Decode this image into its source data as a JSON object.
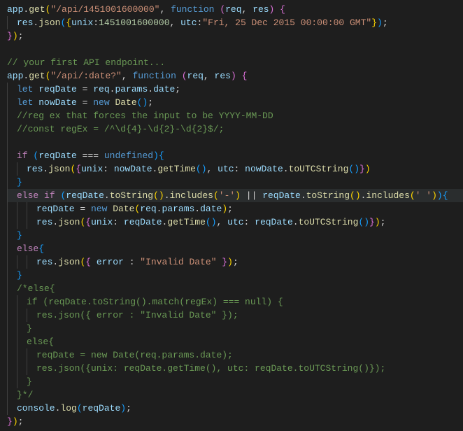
{
  "lines": [
    {
      "indent": 0,
      "tokens": [
        {
          "c": "t-obj",
          "t": "app"
        },
        {
          "c": "t-pun",
          "t": "."
        },
        {
          "c": "t-fn",
          "t": "get"
        },
        {
          "c": "t-brc",
          "t": "("
        },
        {
          "c": "t-str",
          "t": "\"/api/1451001600000\""
        },
        {
          "c": "t-pun",
          "t": ", "
        },
        {
          "c": "t-kw",
          "t": "function"
        },
        {
          "c": "t-pun",
          "t": " "
        },
        {
          "c": "t-brc2",
          "t": "("
        },
        {
          "c": "t-obj",
          "t": "req"
        },
        {
          "c": "t-pun",
          "t": ", "
        },
        {
          "c": "t-obj",
          "t": "res"
        },
        {
          "c": "t-brc2",
          "t": ")"
        },
        {
          "c": "t-pun",
          "t": " "
        },
        {
          "c": "t-brc2",
          "t": "{"
        }
      ]
    },
    {
      "indent": 1,
      "tokens": [
        {
          "c": "t-obj",
          "t": "res"
        },
        {
          "c": "t-pun",
          "t": "."
        },
        {
          "c": "t-fn",
          "t": "json"
        },
        {
          "c": "t-brc3",
          "t": "("
        },
        {
          "c": "t-brc",
          "t": "{"
        },
        {
          "c": "t-obj",
          "t": "unix"
        },
        {
          "c": "t-pun",
          "t": ":"
        },
        {
          "c": "t-num",
          "t": "1451001600000"
        },
        {
          "c": "t-pun",
          "t": ", "
        },
        {
          "c": "t-obj",
          "t": "utc"
        },
        {
          "c": "t-pun",
          "t": ":"
        },
        {
          "c": "t-str",
          "t": "\"Fri, 25 Dec 2015 00:00:00 GMT\""
        },
        {
          "c": "t-brc",
          "t": "}"
        },
        {
          "c": "t-brc3",
          "t": ")"
        },
        {
          "c": "t-pun",
          "t": ";"
        }
      ]
    },
    {
      "indent": 0,
      "tokens": [
        {
          "c": "t-brc2",
          "t": "}"
        },
        {
          "c": "t-brc",
          "t": ")"
        },
        {
          "c": "t-pun",
          "t": ";"
        }
      ]
    },
    {
      "indent": 0,
      "tokens": []
    },
    {
      "indent": 0,
      "tokens": [
        {
          "c": "t-com",
          "t": "// your first API endpoint... "
        }
      ]
    },
    {
      "indent": 0,
      "tokens": [
        {
          "c": "t-obj",
          "t": "app"
        },
        {
          "c": "t-pun",
          "t": "."
        },
        {
          "c": "t-fn",
          "t": "get"
        },
        {
          "c": "t-brc",
          "t": "("
        },
        {
          "c": "t-str",
          "t": "\"/api/:date?\""
        },
        {
          "c": "t-pun",
          "t": ", "
        },
        {
          "c": "t-kw",
          "t": "function"
        },
        {
          "c": "t-pun",
          "t": " "
        },
        {
          "c": "t-brc2",
          "t": "("
        },
        {
          "c": "t-obj",
          "t": "req"
        },
        {
          "c": "t-pun",
          "t": ", "
        },
        {
          "c": "t-obj",
          "t": "res"
        },
        {
          "c": "t-brc2",
          "t": ")"
        },
        {
          "c": "t-pun",
          "t": " "
        },
        {
          "c": "t-brc2",
          "t": "{"
        }
      ]
    },
    {
      "indent": 1,
      "tokens": [
        {
          "c": "t-kw",
          "t": "let"
        },
        {
          "c": "t-pun",
          "t": " "
        },
        {
          "c": "t-obj",
          "t": "reqDate"
        },
        {
          "c": "t-pun",
          "t": " = "
        },
        {
          "c": "t-obj",
          "t": "req"
        },
        {
          "c": "t-pun",
          "t": "."
        },
        {
          "c": "t-obj",
          "t": "params"
        },
        {
          "c": "t-pun",
          "t": "."
        },
        {
          "c": "t-obj",
          "t": "date"
        },
        {
          "c": "t-pun",
          "t": ";"
        }
      ]
    },
    {
      "indent": 1,
      "tokens": [
        {
          "c": "t-kw",
          "t": "let"
        },
        {
          "c": "t-pun",
          "t": " "
        },
        {
          "c": "t-obj",
          "t": "nowDate"
        },
        {
          "c": "t-pun",
          "t": " = "
        },
        {
          "c": "t-kw",
          "t": "new"
        },
        {
          "c": "t-pun",
          "t": " "
        },
        {
          "c": "t-fn",
          "t": "Date"
        },
        {
          "c": "t-brc3",
          "t": "()"
        },
        {
          "c": "t-pun",
          "t": ";"
        }
      ]
    },
    {
      "indent": 1,
      "tokens": [
        {
          "c": "t-com",
          "t": "//reg ex that forces the input to be YYYY-MM-DD"
        }
      ]
    },
    {
      "indent": 1,
      "tokens": [
        {
          "c": "t-com",
          "t": "//const regEx = /^\\d{4}-\\d{2}-\\d{2}$/;"
        }
      ]
    },
    {
      "indent": 1,
      "tokens": []
    },
    {
      "indent": 1,
      "tokens": [
        {
          "c": "t-ctl",
          "t": "if"
        },
        {
          "c": "t-pun",
          "t": " "
        },
        {
          "c": "t-brc3",
          "t": "("
        },
        {
          "c": "t-obj",
          "t": "reqDate"
        },
        {
          "c": "t-pun",
          "t": " === "
        },
        {
          "c": "t-const",
          "t": "undefined"
        },
        {
          "c": "t-brc3",
          "t": ")"
        },
        {
          "c": "t-brc3",
          "t": "{"
        }
      ]
    },
    {
      "indent": 2,
      "tokens": [
        {
          "c": "t-obj",
          "t": "res"
        },
        {
          "c": "t-pun",
          "t": "."
        },
        {
          "c": "t-fn",
          "t": "json"
        },
        {
          "c": "t-brc",
          "t": "("
        },
        {
          "c": "t-brc2",
          "t": "{"
        },
        {
          "c": "t-obj",
          "t": "unix"
        },
        {
          "c": "t-pun",
          "t": ": "
        },
        {
          "c": "t-obj",
          "t": "nowDate"
        },
        {
          "c": "t-pun",
          "t": "."
        },
        {
          "c": "t-fn",
          "t": "getTime"
        },
        {
          "c": "t-brc3",
          "t": "()"
        },
        {
          "c": "t-pun",
          "t": ", "
        },
        {
          "c": "t-obj",
          "t": "utc"
        },
        {
          "c": "t-pun",
          "t": ": "
        },
        {
          "c": "t-obj",
          "t": "nowDate"
        },
        {
          "c": "t-pun",
          "t": "."
        },
        {
          "c": "t-fn",
          "t": "toUTCString"
        },
        {
          "c": "t-brc3",
          "t": "()"
        },
        {
          "c": "t-brc2",
          "t": "}"
        },
        {
          "c": "t-brc",
          "t": ")"
        }
      ]
    },
    {
      "indent": 1,
      "tokens": [
        {
          "c": "t-brc3",
          "t": "}"
        }
      ]
    },
    {
      "indent": 1,
      "hl": true,
      "tokens": [
        {
          "c": "t-ctl",
          "t": "else"
        },
        {
          "c": "t-pun",
          "t": " "
        },
        {
          "c": "t-ctl",
          "t": "if"
        },
        {
          "c": "t-pun",
          "t": " "
        },
        {
          "c": "t-brc3",
          "t": "("
        },
        {
          "c": "t-obj",
          "t": "reqDate"
        },
        {
          "c": "t-pun",
          "t": "."
        },
        {
          "c": "t-fn",
          "t": "toString"
        },
        {
          "c": "t-brc",
          "t": "()"
        },
        {
          "c": "t-pun",
          "t": "."
        },
        {
          "c": "t-fn",
          "t": "includes"
        },
        {
          "c": "t-brc",
          "t": "("
        },
        {
          "c": "t-str",
          "t": "'-'"
        },
        {
          "c": "t-brc",
          "t": ")"
        },
        {
          "c": "t-pun",
          "t": " || "
        },
        {
          "c": "t-obj",
          "t": "reqDate"
        },
        {
          "c": "t-pun",
          "t": "."
        },
        {
          "c": "t-fn",
          "t": "toString"
        },
        {
          "c": "t-brc",
          "t": "()"
        },
        {
          "c": "t-pun",
          "t": "."
        },
        {
          "c": "t-fn",
          "t": "includes"
        },
        {
          "c": "t-brc",
          "t": "("
        },
        {
          "c": "t-str",
          "t": "' '"
        },
        {
          "c": "t-brc",
          "t": ")"
        },
        {
          "c": "t-brc3",
          "t": ")"
        },
        {
          "c": "t-brc3",
          "t": "{"
        }
      ]
    },
    {
      "indent": 3,
      "tokens": [
        {
          "c": "t-obj",
          "t": "reqDate"
        },
        {
          "c": "t-pun",
          "t": " = "
        },
        {
          "c": "t-kw",
          "t": "new"
        },
        {
          "c": "t-pun",
          "t": " "
        },
        {
          "c": "t-fn",
          "t": "Date"
        },
        {
          "c": "t-brc",
          "t": "("
        },
        {
          "c": "t-obj",
          "t": "req"
        },
        {
          "c": "t-pun",
          "t": "."
        },
        {
          "c": "t-obj",
          "t": "params"
        },
        {
          "c": "t-pun",
          "t": "."
        },
        {
          "c": "t-obj",
          "t": "date"
        },
        {
          "c": "t-brc",
          "t": ")"
        },
        {
          "c": "t-pun",
          "t": ";"
        }
      ]
    },
    {
      "indent": 3,
      "tokens": [
        {
          "c": "t-obj",
          "t": "res"
        },
        {
          "c": "t-pun",
          "t": "."
        },
        {
          "c": "t-fn",
          "t": "json"
        },
        {
          "c": "t-brc",
          "t": "("
        },
        {
          "c": "t-brc2",
          "t": "{"
        },
        {
          "c": "t-obj",
          "t": "unix"
        },
        {
          "c": "t-pun",
          "t": ": "
        },
        {
          "c": "t-obj",
          "t": "reqDate"
        },
        {
          "c": "t-pun",
          "t": "."
        },
        {
          "c": "t-fn",
          "t": "getTime"
        },
        {
          "c": "t-brc3",
          "t": "()"
        },
        {
          "c": "t-pun",
          "t": ", "
        },
        {
          "c": "t-obj",
          "t": "utc"
        },
        {
          "c": "t-pun",
          "t": ": "
        },
        {
          "c": "t-obj",
          "t": "reqDate"
        },
        {
          "c": "t-pun",
          "t": "."
        },
        {
          "c": "t-fn",
          "t": "toUTCString"
        },
        {
          "c": "t-brc3",
          "t": "()"
        },
        {
          "c": "t-brc2",
          "t": "}"
        },
        {
          "c": "t-brc",
          "t": ")"
        },
        {
          "c": "t-pun",
          "t": ";"
        }
      ]
    },
    {
      "indent": 1,
      "tokens": [
        {
          "c": "t-brc3",
          "t": "}"
        }
      ]
    },
    {
      "indent": 1,
      "tokens": [
        {
          "c": "t-ctl",
          "t": "else"
        },
        {
          "c": "t-brc3",
          "t": "{"
        }
      ]
    },
    {
      "indent": 3,
      "tokens": [
        {
          "c": "t-obj",
          "t": "res"
        },
        {
          "c": "t-pun",
          "t": "."
        },
        {
          "c": "t-fn",
          "t": "json"
        },
        {
          "c": "t-brc",
          "t": "("
        },
        {
          "c": "t-brc2",
          "t": "{"
        },
        {
          "c": "t-pun",
          "t": " "
        },
        {
          "c": "t-obj",
          "t": "error"
        },
        {
          "c": "t-pun",
          "t": " : "
        },
        {
          "c": "t-str",
          "t": "\"Invalid Date\""
        },
        {
          "c": "t-pun",
          "t": " "
        },
        {
          "c": "t-brc2",
          "t": "}"
        },
        {
          "c": "t-brc",
          "t": ")"
        },
        {
          "c": "t-pun",
          "t": ";"
        }
      ]
    },
    {
      "indent": 1,
      "tokens": [
        {
          "c": "t-brc3",
          "t": "}"
        }
      ]
    },
    {
      "indent": 1,
      "tokens": [
        {
          "c": "t-com",
          "t": "/*else{"
        }
      ]
    },
    {
      "indent": 2,
      "tokens": [
        {
          "c": "t-com",
          "t": "if (reqDate.toString().match(regEx) === null) {"
        }
      ]
    },
    {
      "indent": 3,
      "tokens": [
        {
          "c": "t-com",
          "t": "res.json({ error : \"Invalid Date\" });"
        }
      ]
    },
    {
      "indent": 2,
      "tokens": [
        {
          "c": "t-com",
          "t": "}"
        }
      ]
    },
    {
      "indent": 2,
      "tokens": [
        {
          "c": "t-com",
          "t": "else{"
        }
      ]
    },
    {
      "indent": 3,
      "tokens": [
        {
          "c": "t-com",
          "t": "reqDate = new Date(req.params.date);"
        }
      ]
    },
    {
      "indent": 3,
      "tokens": [
        {
          "c": "t-com",
          "t": "res.json({unix: reqDate.getTime(), utc: reqDate.toUTCString()});"
        }
      ]
    },
    {
      "indent": 2,
      "tokens": [
        {
          "c": "t-com",
          "t": "}"
        }
      ]
    },
    {
      "indent": 1,
      "tokens": [
        {
          "c": "t-com",
          "t": "}*/"
        }
      ]
    },
    {
      "indent": 1,
      "tokens": [
        {
          "c": "t-obj",
          "t": "console"
        },
        {
          "c": "t-pun",
          "t": "."
        },
        {
          "c": "t-fn",
          "t": "log"
        },
        {
          "c": "t-brc3",
          "t": "("
        },
        {
          "c": "t-obj",
          "t": "reqDate"
        },
        {
          "c": "t-brc3",
          "t": ")"
        },
        {
          "c": "t-pun",
          "t": ";"
        }
      ]
    },
    {
      "indent": 0,
      "tokens": [
        {
          "c": "t-brc2",
          "t": "}"
        },
        {
          "c": "t-brc",
          "t": ")"
        },
        {
          "c": "t-pun",
          "t": ";"
        }
      ]
    }
  ]
}
